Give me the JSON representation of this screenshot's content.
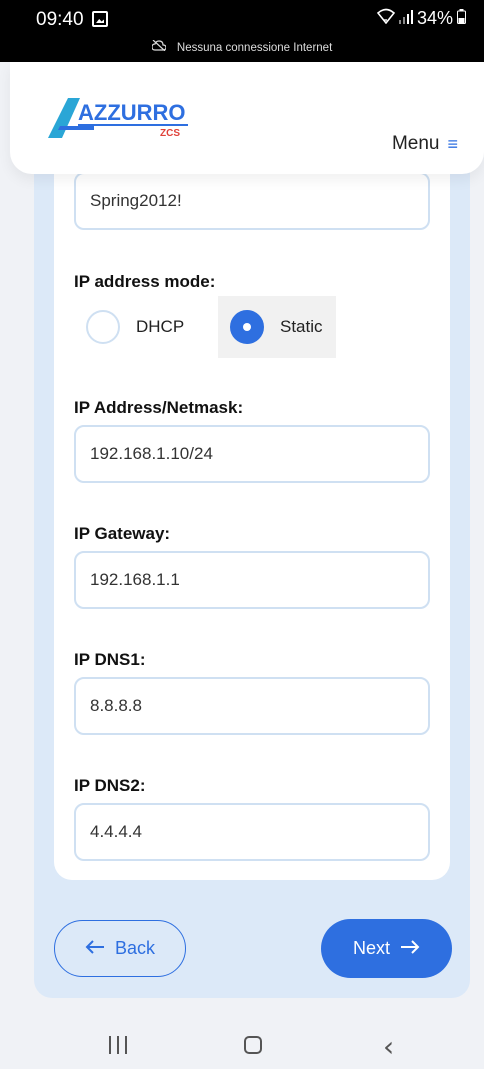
{
  "status_bar": {
    "time": "09:40",
    "battery": "34%",
    "network_notice": "Nessuna connessione Internet"
  },
  "header": {
    "logo_text": "AZZURRO",
    "logo_sub": "ZCS",
    "menu_label": "Menu"
  },
  "form": {
    "password_value": "Spring2012!",
    "ip_mode_label": "IP address mode:",
    "ip_mode_options": [
      "DHCP",
      "Static"
    ],
    "ip_mode_selected": "Static",
    "ip_address_label": "IP Address/Netmask:",
    "ip_address_value": "192.168.1.10/24",
    "gateway_label": "IP Gateway:",
    "gateway_value": "192.168.1.1",
    "dns1_label": "IP DNS1:",
    "dns1_value": "8.8.8.8",
    "dns2_label": "IP DNS2:",
    "dns2_value": "4.4.4.4"
  },
  "buttons": {
    "back_label": "Back",
    "next_label": "Next"
  },
  "colors": {
    "accent": "#2e6fe0",
    "panel_bg": "#dce9f8",
    "input_border": "#cfe0f2"
  }
}
